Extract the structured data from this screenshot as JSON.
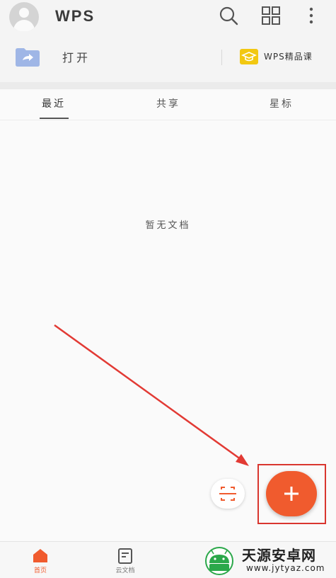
{
  "header": {
    "logo_text": "WPS",
    "icons": [
      "avatar",
      "search-icon",
      "apps-grid-icon",
      "more-vertical-icon"
    ]
  },
  "open_row": {
    "open_label": "打开",
    "course_label": "WPS精品课"
  },
  "tabs": [
    {
      "label": "最近",
      "active": true
    },
    {
      "label": "共享",
      "active": false
    },
    {
      "label": "星标",
      "active": false
    }
  ],
  "content": {
    "empty_message": "暂无文档"
  },
  "bottom_nav": [
    {
      "label": "首页",
      "icon": "home-icon",
      "active": true
    },
    {
      "label": "云文档",
      "icon": "cloud-doc-icon",
      "active": false
    }
  ],
  "watermark": {
    "title": "天源安卓网",
    "url": "www.jytyaz.com"
  },
  "colors": {
    "accent": "#f05b2e",
    "annotation_red": "#e23a34",
    "course_badge": "#f2c811",
    "folder": "#9fb6e6"
  }
}
